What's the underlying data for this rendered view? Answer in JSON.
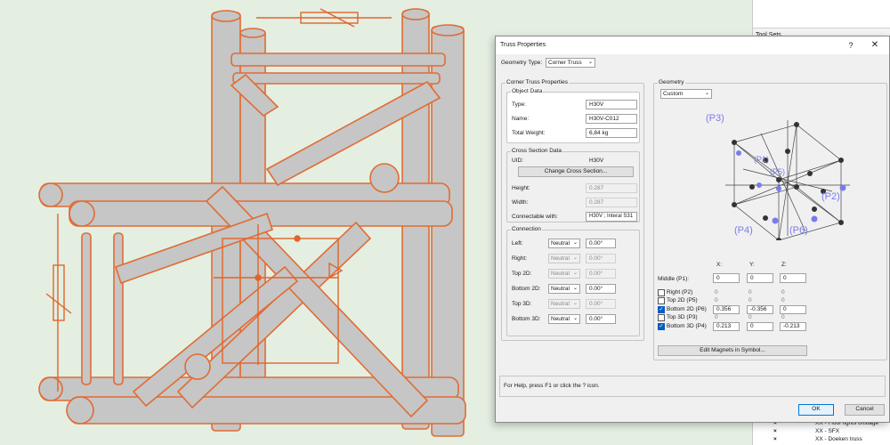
{
  "dialog": {
    "title": "Truss Properties",
    "help_glyph": "?",
    "close_glyph": "✕",
    "geometry_type_label": "Geometry Type:",
    "geometry_type_value": "Corner Truss",
    "corner_truss_group": "Corner Truss Properties",
    "object_data": {
      "title": "Object Data",
      "type_label": "Type:",
      "type_value": "H30V",
      "name_label": "Name:",
      "name_value": "H30V-C012",
      "weight_label": "Total Weight:",
      "weight_value": "6,84 kg"
    },
    "cross_section": {
      "title": "Cross Section Data",
      "uid_label": "UID:",
      "uid_value": "H30V",
      "change_button": "Change Cross Section...",
      "height_label": "Height:",
      "height_value": "0.287",
      "width_label": "Width:",
      "width_value": "0.287",
      "connectable_label": "Connectable with:",
      "connectable_value": "H30V ; Interal S31"
    },
    "connection": {
      "title": "Connection",
      "rows": [
        {
          "label": "Left:",
          "mode": "Neutral",
          "angle": "0.00°",
          "enabled": true
        },
        {
          "label": "Right:",
          "mode": "Neutral",
          "angle": "0.00°",
          "enabled": false
        },
        {
          "label": "Top 2D:",
          "mode": "Neutral",
          "angle": "0.00°",
          "enabled": false
        },
        {
          "label": "Bottom 2D:",
          "mode": "Neutral",
          "angle": "0.00°",
          "enabled": true
        },
        {
          "label": "Top 3D:",
          "mode": "Neutral",
          "angle": "0.00°",
          "enabled": false
        },
        {
          "label": "Bottom 3D:",
          "mode": "Neutral",
          "angle": "0.00°",
          "enabled": true
        }
      ]
    },
    "geometry": {
      "title": "Geometry",
      "preset": "Custom",
      "preview_labels": [
        "(P3)",
        "(P1)",
        "(P5)",
        "(P2)",
        "(P4)",
        "(P6)"
      ],
      "col_x": "X:",
      "col_y": "Y:",
      "col_z": "Z:",
      "middle_label": "Middle (P1):",
      "middle": {
        "x": "0",
        "y": "0",
        "z": "0"
      },
      "points": [
        {
          "label": "Right (P2)",
          "checked": false,
          "x": "0",
          "y": "0",
          "z": "0"
        },
        {
          "label": "Top 2D (P5)",
          "checked": false,
          "x": "0",
          "y": "0",
          "z": "0"
        },
        {
          "label": "Bottom 2D (P6)",
          "checked": true,
          "x": "0.356",
          "y": "-0.356",
          "z": "0"
        },
        {
          "label": "Top 3D (P3)",
          "checked": false,
          "x": "0",
          "y": "0",
          "z": "0"
        },
        {
          "label": "Bottom 3D (P4)",
          "checked": true,
          "x": "0.213",
          "y": "0",
          "z": "-0.213"
        }
      ],
      "edit_magnets_button": "Edit Magnets in Symbol..."
    },
    "status_text": "For Help, press F1 or click the ? icon.",
    "ok_button": "OK",
    "cancel_button": "Cancel"
  },
  "side_panel": {
    "tool_sets_label": "Tool Sets",
    "layers": [
      {
        "mark": "×",
        "name": "XX - Floor lights offstage"
      },
      {
        "mark": "×",
        "name": "XX - SFX"
      },
      {
        "mark": "×",
        "name": "XX - Doeken truss"
      }
    ]
  },
  "colors": {
    "truss_fill": "#c4c4c4",
    "truss_outline": "#e2642a",
    "viewport_bg": "#e4efe2",
    "point_marker": "#7a7af0",
    "checkbox_on": "#0a5cc2"
  }
}
